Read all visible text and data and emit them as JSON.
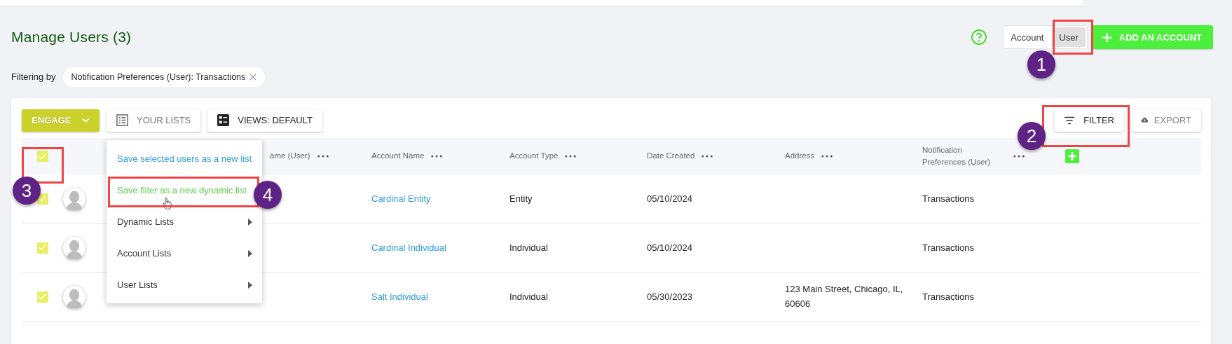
{
  "page": {
    "title": "Manage Users (3)"
  },
  "header": {
    "toggle": [
      {
        "label": "Account",
        "selected": false
      },
      {
        "label": "User",
        "selected": true
      }
    ],
    "add_button": "ADD AN ACCOUNT"
  },
  "filter_bar": {
    "label": "Filtering by",
    "chip": "Notification Preferences (User): Transactions"
  },
  "toolbar": {
    "engage": "ENGAGE",
    "your_lists": "YOUR LISTS",
    "views": "VIEWS: DEFAULT",
    "filter": "FILTER",
    "export": "EXPORT"
  },
  "table": {
    "select_all_checked": true,
    "columns": [
      {
        "label": "ame (User)"
      },
      {
        "label": "Account Name"
      },
      {
        "label": "Account Type"
      },
      {
        "label": "Date Created"
      },
      {
        "label": "Address"
      },
      {
        "label": "Notification Preferences (User)"
      }
    ],
    "rows": [
      {
        "checked": true,
        "account_name": "Cardinal Entity",
        "account_type": "Entity",
        "date_created": "05/10/2024",
        "address": "",
        "notification_preferences": "Transactions"
      },
      {
        "checked": true,
        "account_name": "Cardinal Individual",
        "account_type": "Individual",
        "date_created": "05/10/2024",
        "address": "",
        "notification_preferences": "Transactions"
      },
      {
        "checked": true,
        "account_name": "Salt Individual",
        "account_type": "Individual",
        "date_created": "05/30/2023",
        "address": "123 Main Street, Chicago, IL, 60606",
        "notification_preferences": "Transactions"
      }
    ]
  },
  "menu": {
    "items": [
      {
        "label": "Save selected users as a new list",
        "kind": "action",
        "highlighted": false
      },
      {
        "label": "Save filter as a new dynamic list",
        "kind": "action",
        "highlighted": true
      },
      {
        "label": "Dynamic Lists",
        "kind": "submenu",
        "highlighted": false
      },
      {
        "label": "Account Lists",
        "kind": "submenu",
        "highlighted": false
      },
      {
        "label": "User Lists",
        "kind": "submenu",
        "highlighted": false
      }
    ]
  },
  "annotations": [
    {
      "number": "1"
    },
    {
      "number": "2"
    },
    {
      "number": "3"
    },
    {
      "number": "4"
    }
  ]
}
